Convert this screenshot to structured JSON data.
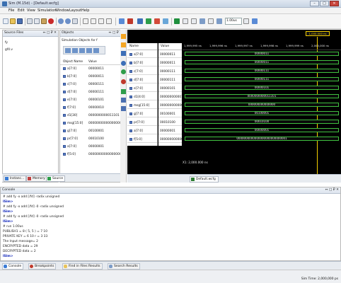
{
  "window": {
    "title": "Sim (M.15d) - [Default.wcfg]",
    "buttons": [
      "–",
      "□",
      "✕"
    ]
  },
  "menu": [
    "File",
    "Edit",
    "View",
    "Simulation",
    "Window",
    "Layout",
    "Help"
  ],
  "toolbar": {
    "run_time": "1.00us",
    "icons": [
      "new-file-icon",
      "open-icon",
      "save-icon",
      "cut-icon",
      "copy-icon",
      "paste-icon",
      "delete-icon",
      "undo-icon",
      "redo-icon",
      "find-icon",
      "zoom-in-icon",
      "zoom-out-icon",
      "zoom-fit-icon",
      "cursor-icon",
      "marker-icon",
      "restart-icon",
      "run-all-icon",
      "run-for-icon",
      "step-icon",
      "break-icon"
    ]
  },
  "source_files": {
    "title": "Source Files",
    "controls": "↔ □ ₽ ✕",
    "items": [
      "fy",
      "gf4.v"
    ]
  },
  "objects": {
    "title": "Objects",
    "controls": "↔ □ ₽ ✕",
    "subtitle": "Simulation Objects for f",
    "columns": [
      "Object Name",
      "Value"
    ],
    "rows": [
      {
        "name": "a[7:0]",
        "value": "00000011"
      },
      {
        "name": "b[7:0]",
        "value": "00000011"
      },
      {
        "name": "c[7:0]",
        "value": "00000111"
      },
      {
        "name": "d[7:0]",
        "value": "00000111"
      },
      {
        "name": "e[7:0]",
        "value": "00000101"
      },
      {
        "name": "f[7:0]",
        "value": "00000010"
      },
      {
        "name": "d1[30]",
        "value": "0000000000011101"
      },
      {
        "name": "msg[15:0]",
        "value": "000000000000000000"
      },
      {
        "name": "g[7:0]",
        "value": "00100001"
      },
      {
        "name": "pr[7:0]",
        "value": "00010100"
      },
      {
        "name": "a[7:0]",
        "value": "00000001"
      },
      {
        "name": "f[5:0]",
        "value": "000000000000000000"
      }
    ]
  },
  "left_tabs": [
    "Instanc...",
    "Memory",
    "Source"
  ],
  "wave": {
    "names_header": "Name",
    "values_header": "Value",
    "cursor_value": "1,000.000 ns",
    "time_labels": [
      "1,999,995 ns",
      "1,999,996 ns",
      "1,999,997 ns",
      "1,999,998 ns",
      "1,999,999 ns",
      "2,000,000 ns"
    ],
    "signals": [
      {
        "name": "a[7:0]",
        "value": "00000011",
        "bus": "00000011"
      },
      {
        "name": "b[7:0]",
        "value": "00000011",
        "bus": "00000011"
      },
      {
        "name": "c[7:0]",
        "value": "00000111",
        "bus": "00000111"
      },
      {
        "name": "d[7:0]",
        "value": "00000111",
        "bus": "00000111"
      },
      {
        "name": "e[7:0]",
        "value": "00000101",
        "bus": "00000101"
      },
      {
        "name": "d1[4:0]",
        "value": "0000000000011101",
        "bus": "0000000000011101"
      },
      {
        "name": "msg[15:0]",
        "value": "000000000000000",
        "bus": "000000000000000"
      },
      {
        "name": "g[7:0]",
        "value": "00100001",
        "bus": "00100001"
      },
      {
        "name": "pr[7:0]",
        "value": "00010100",
        "bus": "00010100"
      },
      {
        "name": "a[7:0]",
        "value": "00000001",
        "bus": "00000001"
      },
      {
        "name": "f[5:0]",
        "value": "0000000000000000",
        "bus": "0000000000000000000000000001"
      }
    ],
    "footer_time": "X1: 2,000.000 ns",
    "tab": "Default.wcfg"
  },
  "console": {
    "title": "Console",
    "controls": "↔ □ ₽ ✕",
    "lines": [
      {
        "text": "# add fy -x add [/fd] -radix unsigned",
        "prompt": false
      },
      {
        "text": "ISim>",
        "prompt": true
      },
      {
        "text": "# add fy -x add [/fd] -0 -radix unsigned",
        "prompt": false
      },
      {
        "text": "ISim>",
        "prompt": true
      },
      {
        "text": "# add fy -x add [/fd] -0 -radix unsigned",
        "prompt": false
      },
      {
        "text": "ISim>",
        "prompt": true
      },
      {
        "text": "# run 1.00us",
        "prompt": false
      },
      {
        "text": "PUBLISH1 = 8 ( 5, 5 ) = 7 10",
        "prompt": false
      },
      {
        "text": "PRIVATE KEY = 6 10 r = 3 33",
        "prompt": false
      },
      {
        "text": "The Input message= 2",
        "prompt": false
      },
      {
        "text": "ENCRYPTED data = 29",
        "prompt": false
      },
      {
        "text": "DECRYPTED data = 2",
        "prompt": false
      },
      {
        "text": "ISim>",
        "prompt": true
      }
    ]
  },
  "bottom_tabs": [
    "Console",
    "Breakpoints",
    "Find in Files Results",
    "Search Results"
  ],
  "status": {
    "sim_time": "Sim Time: 2,000,000 ps"
  },
  "colors": {
    "wave_bg": "#000000",
    "bus_green": "#3fbf3f",
    "cursor_yellow": "#f5d000",
    "prompt_blue": "#0b21b8"
  }
}
